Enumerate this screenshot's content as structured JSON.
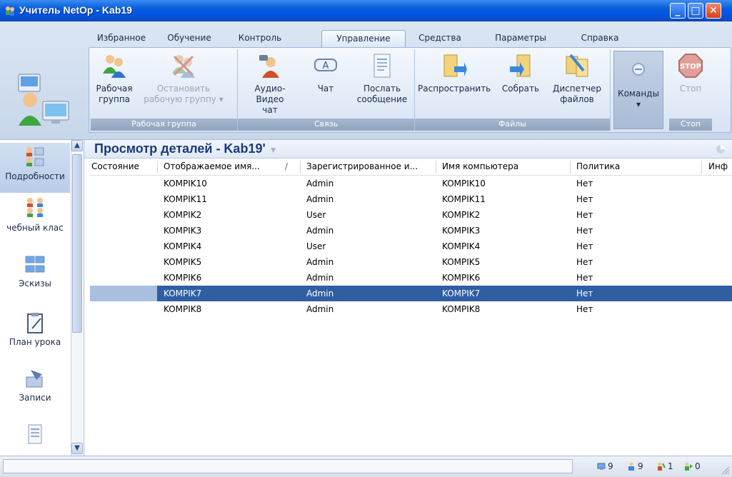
{
  "window": {
    "title": "Учитель NetOp - Kab19"
  },
  "tabs": [
    "Избранное",
    "Обучение",
    "Контроль",
    "Управление",
    "Средства",
    "Параметры",
    "Справка"
  ],
  "active_tab": "Управление",
  "ribbon": {
    "groups": {
      "workgroup": "Рабочая группа",
      "comms": "Связь",
      "files": "Файлы",
      "stop": "Стоп"
    },
    "buttons": {
      "workgroup_l1": "Рабочая",
      "workgroup_l2": "группа",
      "stop_workgroup_l1": "Остановить",
      "stop_workgroup_l2": "рабочую группу",
      "av_chat_l1": "Аудио-Видео",
      "av_chat_l2": "чат",
      "chat": "Чат",
      "send_msg_l1": "Послать",
      "send_msg_l2": "сообщение",
      "distribute": "Распространить",
      "collect": "Собрать",
      "file_mgr_l1": "Диспетчер",
      "file_mgr_l2": "файлов",
      "commands": "Команды",
      "stop": "Стоп"
    }
  },
  "leftnav": {
    "items": [
      {
        "label": "Подробности"
      },
      {
        "label": "чебный клас"
      },
      {
        "label": "Эскизы"
      },
      {
        "label": "План урока"
      },
      {
        "label": "Записи"
      }
    ]
  },
  "view": {
    "title": "Просмотр деталей - Kab19'"
  },
  "table": {
    "columns": [
      "Состояние",
      "Отображаемое имя...",
      "Зарегистрированное и...",
      "Имя компьютера",
      "Политика",
      "Инф"
    ],
    "sort_indicator": "/",
    "rows": [
      [
        "",
        "KOMPIK10",
        "Admin",
        "KOMPIK10",
        "Нет"
      ],
      [
        "",
        "KOMPIK11",
        "Admin",
        "KOMPIK11",
        "Нет"
      ],
      [
        "",
        "KOMPIK2",
        "User",
        "KOMPIK2",
        "Нет"
      ],
      [
        "",
        "KOMPIK3",
        "Admin",
        "KOMPIK3",
        "Нет"
      ],
      [
        "",
        "KOMPIK4",
        "User",
        "KOMPIK4",
        "Нет"
      ],
      [
        "",
        "KOMPIK5",
        "Admin",
        "KOMPIK5",
        "Нет"
      ],
      [
        "",
        "KOMPIK6",
        "Admin",
        "KOMPIK6",
        "Нет"
      ],
      [
        "",
        "KOMPIK7",
        "Admin",
        "KOMPIK7",
        "Нет"
      ],
      [
        "",
        "KOMPIK8",
        "Admin",
        "KOMPIK8",
        "Нет"
      ]
    ],
    "selected_row": 7
  },
  "status": {
    "total": "9",
    "students": "9",
    "workgroup": "1",
    "other": "0"
  },
  "colors": {
    "selection": "#2f5ea3",
    "title_bar": "#0054e3",
    "header_text": "#1b3a78"
  }
}
